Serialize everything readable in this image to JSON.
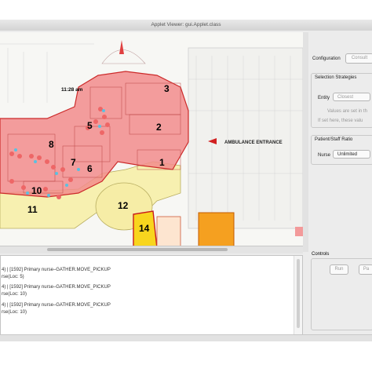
{
  "window": {
    "title": "Applet Viewer: gui.Applet.class"
  },
  "map": {
    "time_label": "11:28 am",
    "entrance_label": "AMBULANCE ENTRANCE",
    "zones": [
      {
        "label": "1"
      },
      {
        "label": "2"
      },
      {
        "label": "3"
      },
      {
        "label": "5"
      },
      {
        "label": "6"
      },
      {
        "label": "7"
      },
      {
        "label": "8"
      },
      {
        "label": "10"
      },
      {
        "label": "11"
      },
      {
        "label": "12"
      },
      {
        "label": "14"
      }
    ],
    "colors": {
      "ed_red": "#f28c8c",
      "ed_border": "#cc2a2a",
      "yellow": "#f7f0b0",
      "orange": "#f5a020",
      "bright_yellow": "#f8d51e"
    }
  },
  "log": {
    "lines": [
      "4) | [1592] Primary nurse–GATHER.MOVE_PICKUP",
      "rse(Loc: 5)",
      "4) | [1592] Primary nurse–GATHER.MOVE_PICKUP",
      "rse(Loc: 10)",
      "4) | [1592] Primary nurse–GATHER.MOVE_PICKUP",
      "rse(Loc: 10)"
    ]
  },
  "right_panel": {
    "configuration_label": "Configuration",
    "configuration_button": "Consult",
    "selection_title": "Selection Strategies",
    "entity_label": "Entity",
    "entity_value": "Closest",
    "hint_line1": "Values are set in th",
    "hint_line2": "If set here, these valu",
    "ratio_title": "Patient/Staff Ratio",
    "nurse_label": "Nurse",
    "nurse_value": "Unlimited"
  },
  "controls": {
    "title": "Controls",
    "run_label": "Run",
    "pause_label": "Pa"
  }
}
